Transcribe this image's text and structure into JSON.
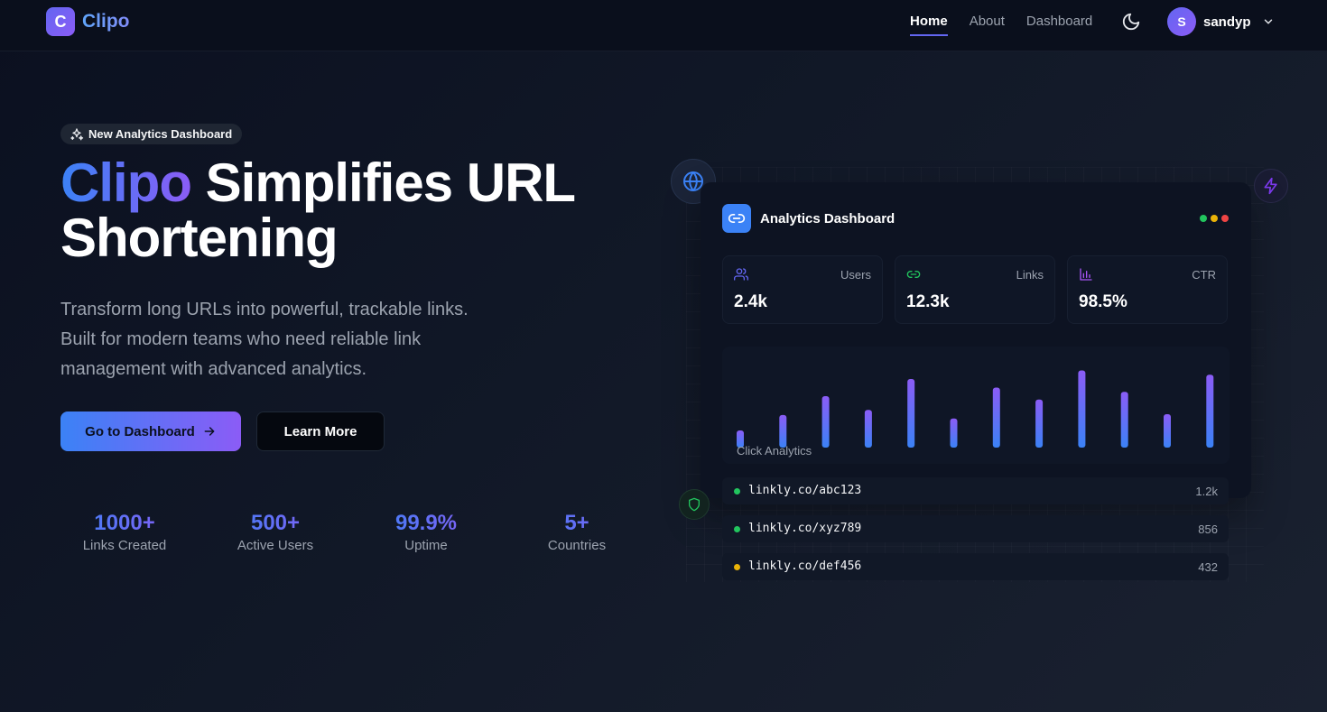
{
  "nav": {
    "logo_letter": "C",
    "logo_text": "Clipo",
    "links": [
      {
        "label": "Home",
        "active": true
      },
      {
        "label": "About",
        "active": false
      },
      {
        "label": "Dashboard",
        "active": false
      }
    ],
    "theme_icon": "moon-icon",
    "user": {
      "initial": "S",
      "name": "sandyp"
    }
  },
  "hero": {
    "badge": "New Analytics Dashboard",
    "headline_accent": "Clipo",
    "headline_rest_line1": " Simplifies URL",
    "headline_line2": "Shortening",
    "subtext_lines": [
      "Transform long URLs into powerful, trackable links.",
      "Built for modern teams who need reliable link",
      "management with advanced analytics."
    ],
    "primary_button": "Go to Dashboard",
    "secondary_button": "Learn More",
    "stats": [
      {
        "value": "1000+",
        "label": "Links Created"
      },
      {
        "value": "500+",
        "label": "Active Users"
      },
      {
        "value": "99.9%",
        "label": "Uptime"
      },
      {
        "value": "5+",
        "label": "Countries"
      }
    ]
  },
  "dashboard": {
    "title": "Analytics Dashboard",
    "window_dots": [
      "#22c55e",
      "#eab308",
      "#ef4444"
    ],
    "metrics": [
      {
        "label": "Users",
        "value": "2.4k",
        "icon": "users-icon",
        "color": "#6366f1"
      },
      {
        "label": "Links",
        "value": "12.3k",
        "icon": "link-icon",
        "color": "#22c55e"
      },
      {
        "label": "CTR",
        "value": "98.5%",
        "icon": "bar-chart-icon",
        "color": "#a855f7"
      }
    ],
    "chart_label": "Click Analytics",
    "chart_bar_levels": [
      0.2,
      0.38,
      0.6,
      0.44,
      0.8,
      0.34,
      0.7,
      0.56,
      0.9,
      0.65,
      0.39,
      0.85
    ],
    "links": [
      {
        "url": "linkly.co/abc123",
        "count": "1.2k",
        "status_color": "#22c55e"
      },
      {
        "url": "linkly.co/xyz789",
        "count": "856",
        "status_color": "#22c55e"
      },
      {
        "url": "linkly.co/def456",
        "count": "432",
        "status_color": "#eab308"
      }
    ]
  },
  "colors": {
    "accent_blue": "#3b82f6",
    "accent_purple": "#8b5cf6",
    "background": "#0b1020"
  }
}
